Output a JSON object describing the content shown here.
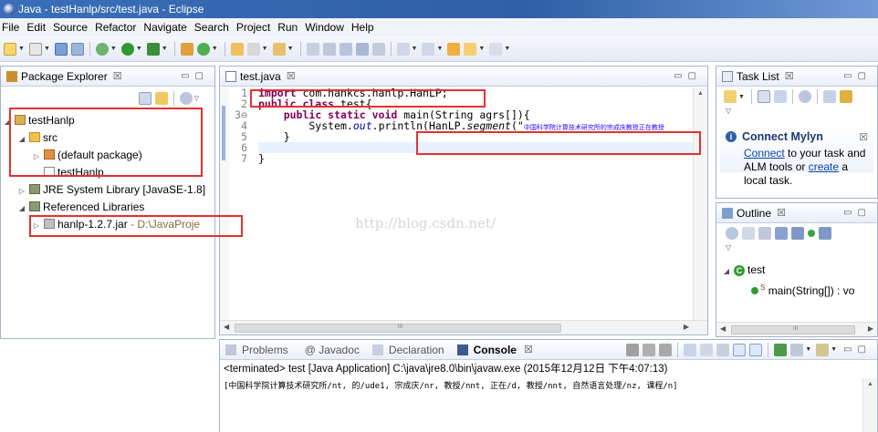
{
  "window": {
    "title": "Java - testHanlp/src/test.java - Eclipse"
  },
  "menu": [
    "File",
    "Edit",
    "Source",
    "Refactor",
    "Navigate",
    "Search",
    "Project",
    "Run",
    "Window",
    "Help"
  ],
  "package_explorer": {
    "tab_title": "Package Explorer",
    "tree": [
      {
        "label": "testHanlp",
        "suffix": ""
      },
      {
        "label": "src",
        "suffix": ""
      },
      {
        "label": "(default package)",
        "suffix": ""
      },
      {
        "label": "testHanlp",
        "suffix": ""
      },
      {
        "label": "JRE System Library [JavaSE-1.8]",
        "suffix": ""
      },
      {
        "label": "Referenced Libraries",
        "suffix": ""
      },
      {
        "label": "hanlp-1.2.7.jar",
        "suffix": " - D:\\JavaProje"
      }
    ]
  },
  "editor": {
    "tab_title": "test.java",
    "line_numbers": [
      "1",
      "2",
      "3⊖",
      "4",
      "5",
      "6",
      "7"
    ],
    "line1_kw": "import",
    "line1_rest": " com.hankcs.hanlp.HanLP;",
    "line2_kw": "public class",
    "line2_rest": " test{",
    "line3_indent": "    ",
    "line3_kw": "public static void",
    "line3_rest": " main(String agrs[]){",
    "line4_a": "        System.",
    "line4_out": "out",
    "line4_b": ".println(HanLP.",
    "line4_segment": "segment",
    "line4_c": "(\"",
    "line4_str": "中国科学院计算技术研究所的宗成庆教授正在教授",
    "line5": "    }",
    "line6": "",
    "line7": "}",
    "watermark": "http://blog.csdn.net/"
  },
  "task_list": {
    "tab_title": "Task List",
    "mylyn_title": "Connect Mylyn",
    "mylyn_link1": "Connect",
    "mylyn_text1": " to your task and",
    "mylyn_text2": "ALM tools or ",
    "mylyn_link2": "create",
    "mylyn_text3": " a",
    "mylyn_text4": "local task."
  },
  "outline": {
    "tab_title": "Outline",
    "class_name": "test",
    "method_sup": "S",
    "method": "main(String[]) : vo"
  },
  "bottom_tabs": [
    {
      "label": "Problems",
      "active": false
    },
    {
      "label": "@ Javadoc",
      "active": false
    },
    {
      "label": "Declaration",
      "active": false
    },
    {
      "label": "Console",
      "active": true
    }
  ],
  "console": {
    "status": "<terminated> test [Java Application] C:\\java\\jre8.0\\bin\\javaw.exe (2015年12月12日 下午4:07:13)",
    "output": "[中国科学院计算技术研究所/nt, 的/ude1, 宗成庆/nr, 教授/nnt, 正在/d, 教授/nnt, 自然语言处理/nz, 课程/n]"
  }
}
